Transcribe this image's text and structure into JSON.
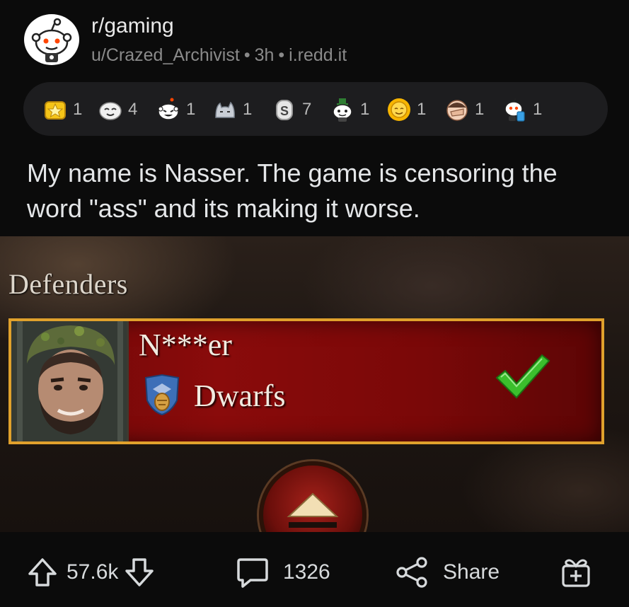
{
  "post": {
    "subreddit": "r/gaming",
    "author": "u/Crazed_Archivist",
    "separator": "•",
    "age": "3h",
    "domain": "i.redd.it",
    "title": "My name is Nasser. The game is censoring the word \"ass\" and its making it worse."
  },
  "awards": [
    {
      "icon": "gold-star-award-icon",
      "count": "1"
    },
    {
      "icon": "wholesome-award-icon",
      "count": "4"
    },
    {
      "icon": "snoo-laugh-award-icon",
      "count": "1"
    },
    {
      "icon": "cat-award-icon",
      "count": "1"
    },
    {
      "icon": "silver-coin-award-icon",
      "count": "7"
    },
    {
      "icon": "snoo-top-hat-award-icon",
      "count": "1"
    },
    {
      "icon": "sun-award-icon",
      "count": "1"
    },
    {
      "icon": "facepalm-award-icon",
      "count": "1"
    },
    {
      "icon": "snoo-drink-award-icon",
      "count": "1"
    }
  ],
  "image": {
    "section_label": "Defenders",
    "player_name": "N***er",
    "faction": "Dwarfs",
    "status_icon": "check-icon"
  },
  "actions": {
    "votes": "57.6k",
    "comments": "1326",
    "share": "Share"
  },
  "colors": {
    "background": "#0b0b0b",
    "award_bar": "#1d1d1f",
    "panel_red": "#8a0b0b",
    "panel_border": "#e0a12c",
    "check_green": "#3bbf2c"
  }
}
